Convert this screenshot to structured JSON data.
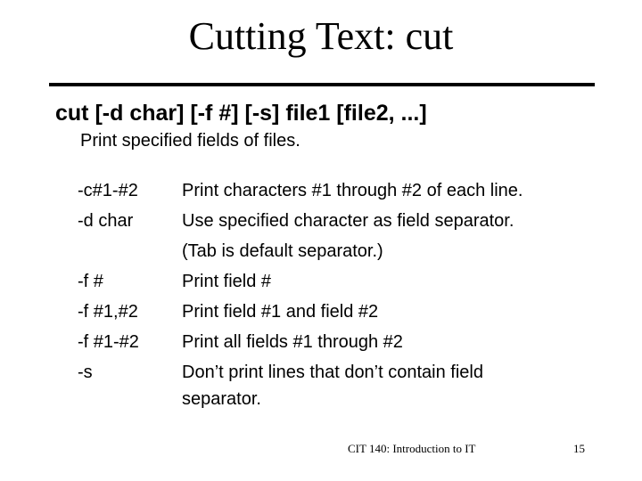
{
  "slide": {
    "title": "Cutting Text: cut",
    "syntax": "cut [-d char] [-f #] [-s] file1 [file2, ...]",
    "subtitle": "Print specified fields of files.",
    "options": [
      {
        "flag": "-c#1-#2",
        "desc": [
          "Print characters #1 through #2 of each line."
        ]
      },
      {
        "flag": "-d char",
        "desc": [
          "Use specified character as field separator.",
          "(Tab is default separator.)"
        ]
      },
      {
        "flag": "-f #",
        "desc": [
          "Print field #"
        ]
      },
      {
        "flag": "-f #1,#2",
        "desc": [
          "Print field #1 and field #2"
        ]
      },
      {
        "flag": "-f #1-#2",
        "desc": [
          "Print all fields #1 through #2"
        ]
      },
      {
        "flag": "-s",
        "desc": [
          "Don’t print lines that don’t contain field",
          "separator."
        ]
      }
    ],
    "footer": {
      "course": "CIT 140: Introduction to IT",
      "page": "15"
    }
  }
}
